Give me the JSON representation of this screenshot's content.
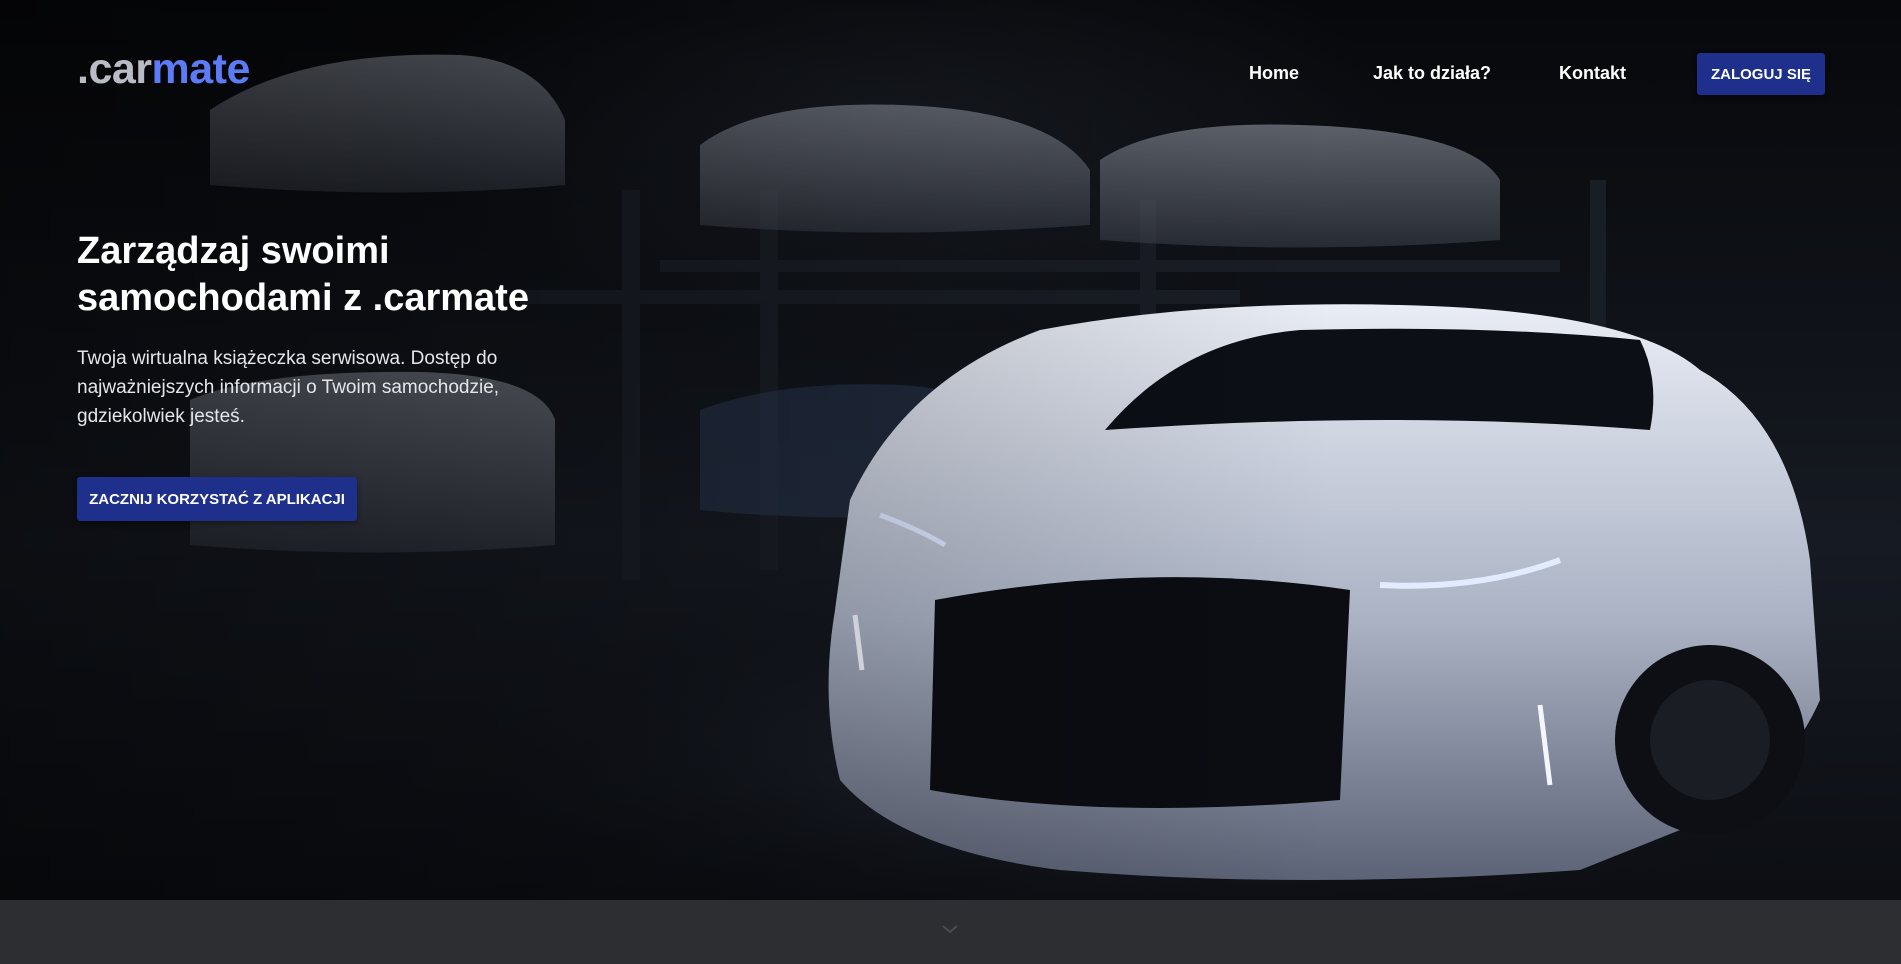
{
  "brand": {
    "logo_part_a": ".car",
    "logo_part_b": "mate",
    "accent_color": "#5b7cf6",
    "button_color": "#1e2f8c"
  },
  "nav": {
    "items": [
      {
        "label": "Home"
      },
      {
        "label": "Jak to działa?"
      },
      {
        "label": "Kontakt"
      }
    ],
    "login_label": "ZALOGUJ SIĘ"
  },
  "hero": {
    "title_line_1": "Zarządzaj swoimi",
    "title_line_2": "samochodami z .carmate",
    "subtitle": "Twoja wirtualna książeczka serwisowa. Dostęp do najważniejszych informacji o Twoim samochodzie, gdziekolwiek jesteś.",
    "cta_label": "ZACZNIJ KORZYSTAĆ Z APLIKACJI",
    "background_icon": "car-garage-photo"
  },
  "footer_strip": {
    "scroll_icon": "chevron-down-icon"
  }
}
